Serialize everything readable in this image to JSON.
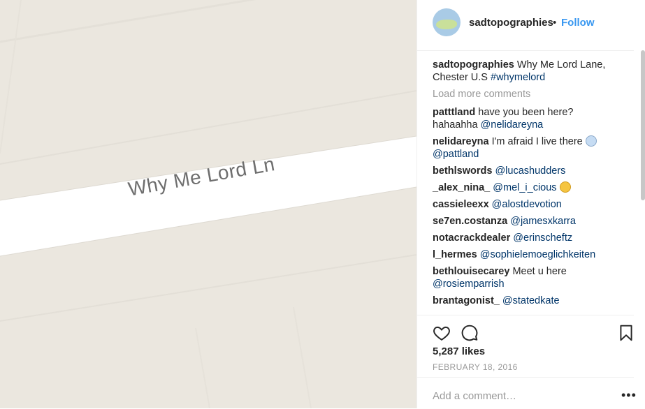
{
  "photo": {
    "street_label": "Why Me Lord Ln"
  },
  "header": {
    "username": "sadtopographies",
    "separator": "•",
    "follow_label": "Follow"
  },
  "caption": {
    "user": "sadtopographies",
    "text": "Why Me Lord Lane, Chester U.S",
    "hashtag": "#whymelord"
  },
  "load_more_label": "Load more comments",
  "comments": [
    {
      "user": "patttland",
      "text": "have you been here? hahaahha",
      "mention": "@nelidareyna"
    },
    {
      "user": "nelidareyna",
      "text": "I'm afraid I live there",
      "emoji": "fearful-face",
      "mention": "@pattland"
    },
    {
      "user": "bethlswords",
      "text": "",
      "mention": "@lucashudders"
    },
    {
      "user": "_alex_nina_",
      "text": "",
      "mention": "@mel_i_cious",
      "emoji": "laughing-face"
    },
    {
      "user": "cassieleexx",
      "text": "",
      "mention": "@alostdevotion"
    },
    {
      "user": "se7en.costanza",
      "text": "",
      "mention": "@jamesxkarra"
    },
    {
      "user": "notacrackdealer",
      "text": "",
      "mention": "@erinscheftz"
    },
    {
      "user": "l_hermes",
      "text": "",
      "mention": "@sophielemoeglichkeiten"
    },
    {
      "user": "bethlouisecarey",
      "text": "Meet u here",
      "mention": "@rosiemparrish"
    },
    {
      "user": "brantagonist_",
      "text": "",
      "mention": "@statedkate"
    }
  ],
  "likes": "5,287 likes",
  "date": "FEBRUARY 18, 2016",
  "add_comment_placeholder": "Add a comment…",
  "more_label": "•••",
  "colors": {
    "accent": "#3897f0",
    "mention": "#003569",
    "map_bg": "#ebe7df",
    "road": "#ffffff"
  }
}
